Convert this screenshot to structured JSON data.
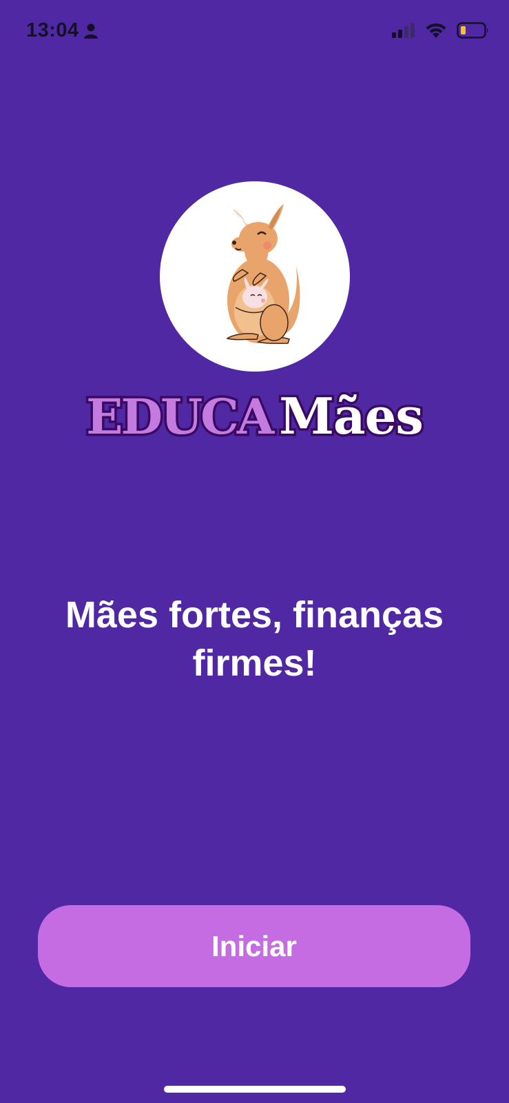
{
  "status_bar": {
    "time": "13:04",
    "icons": [
      "person-icon",
      "cellular-signal-icon",
      "wifi-icon",
      "battery-low-icon"
    ],
    "battery_color": "#F5C518"
  },
  "brand": {
    "part1": "EDUCA",
    "part2": "Mães",
    "part1_color": "#C47BE0",
    "part2_color": "#FFFFFF",
    "outline_color": "#3A0A63"
  },
  "logo": {
    "icon": "kangaroo-with-joey-icon"
  },
  "tagline": "Mães fortes, finanças firmes!",
  "start_button": {
    "label": "Iniciar",
    "color": "#C66CE3"
  },
  "theme": {
    "background": "#5128A3"
  }
}
